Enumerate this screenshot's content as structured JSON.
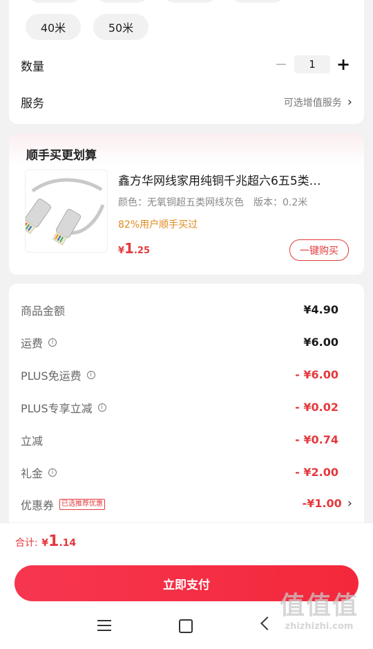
{
  "spec": {
    "chips": [
      "40米",
      "50米"
    ]
  },
  "quantity": {
    "label": "数量",
    "value": "1",
    "minus": "−",
    "plus": "+"
  },
  "service": {
    "label": "服务",
    "value": "可选增值服务",
    "chevron": "›"
  },
  "bundle": {
    "title": "顺手买更划算",
    "product_title": "鑫方华网线家用纯铜千兆超六6五5类…",
    "spec_text": "颜色：无氧铜超五类网线灰色　版本：0.2米",
    "promo": "82%用户顺手买过",
    "price_symbol": "¥",
    "price_int": "1",
    "price_dec": ".25",
    "buy_button": "一键购买"
  },
  "summary": {
    "rows": [
      {
        "label": "商品金额",
        "info": false,
        "value": "¥4.90",
        "red": false
      },
      {
        "label": "运费",
        "info": true,
        "value": "¥6.00",
        "red": false
      },
      {
        "label": "PLUS免运费",
        "info": true,
        "value": "- ¥6.00",
        "red": true
      },
      {
        "label": "PLUS专享立减",
        "info": true,
        "value": "- ¥0.02",
        "red": true
      },
      {
        "label": "立减",
        "info": false,
        "value": "- ¥0.74",
        "red": true
      },
      {
        "label": "礼金",
        "info": true,
        "value": "- ¥2.00",
        "red": true
      }
    ],
    "coupon_label": "优惠券",
    "coupon_tag": "已选推荐优惠",
    "coupon_value": "-¥1.00",
    "coupon_chevron": "›"
  },
  "footer": {
    "total_label": "合计:",
    "total_symbol": "¥",
    "total_int": "1",
    "total_dec": ".14",
    "pay_button": "立即支付"
  },
  "navbar": {
    "menu_icon": "menu-icon",
    "home_icon": "home-icon",
    "back_icon": "back-icon"
  },
  "watermark": {
    "text_top": "值值值",
    "text_bottom": "zhizhizhi.com"
  },
  "colors": {
    "accent": "#e4393c",
    "promo": "#e08a1e",
    "background": "#f2f2f2"
  }
}
